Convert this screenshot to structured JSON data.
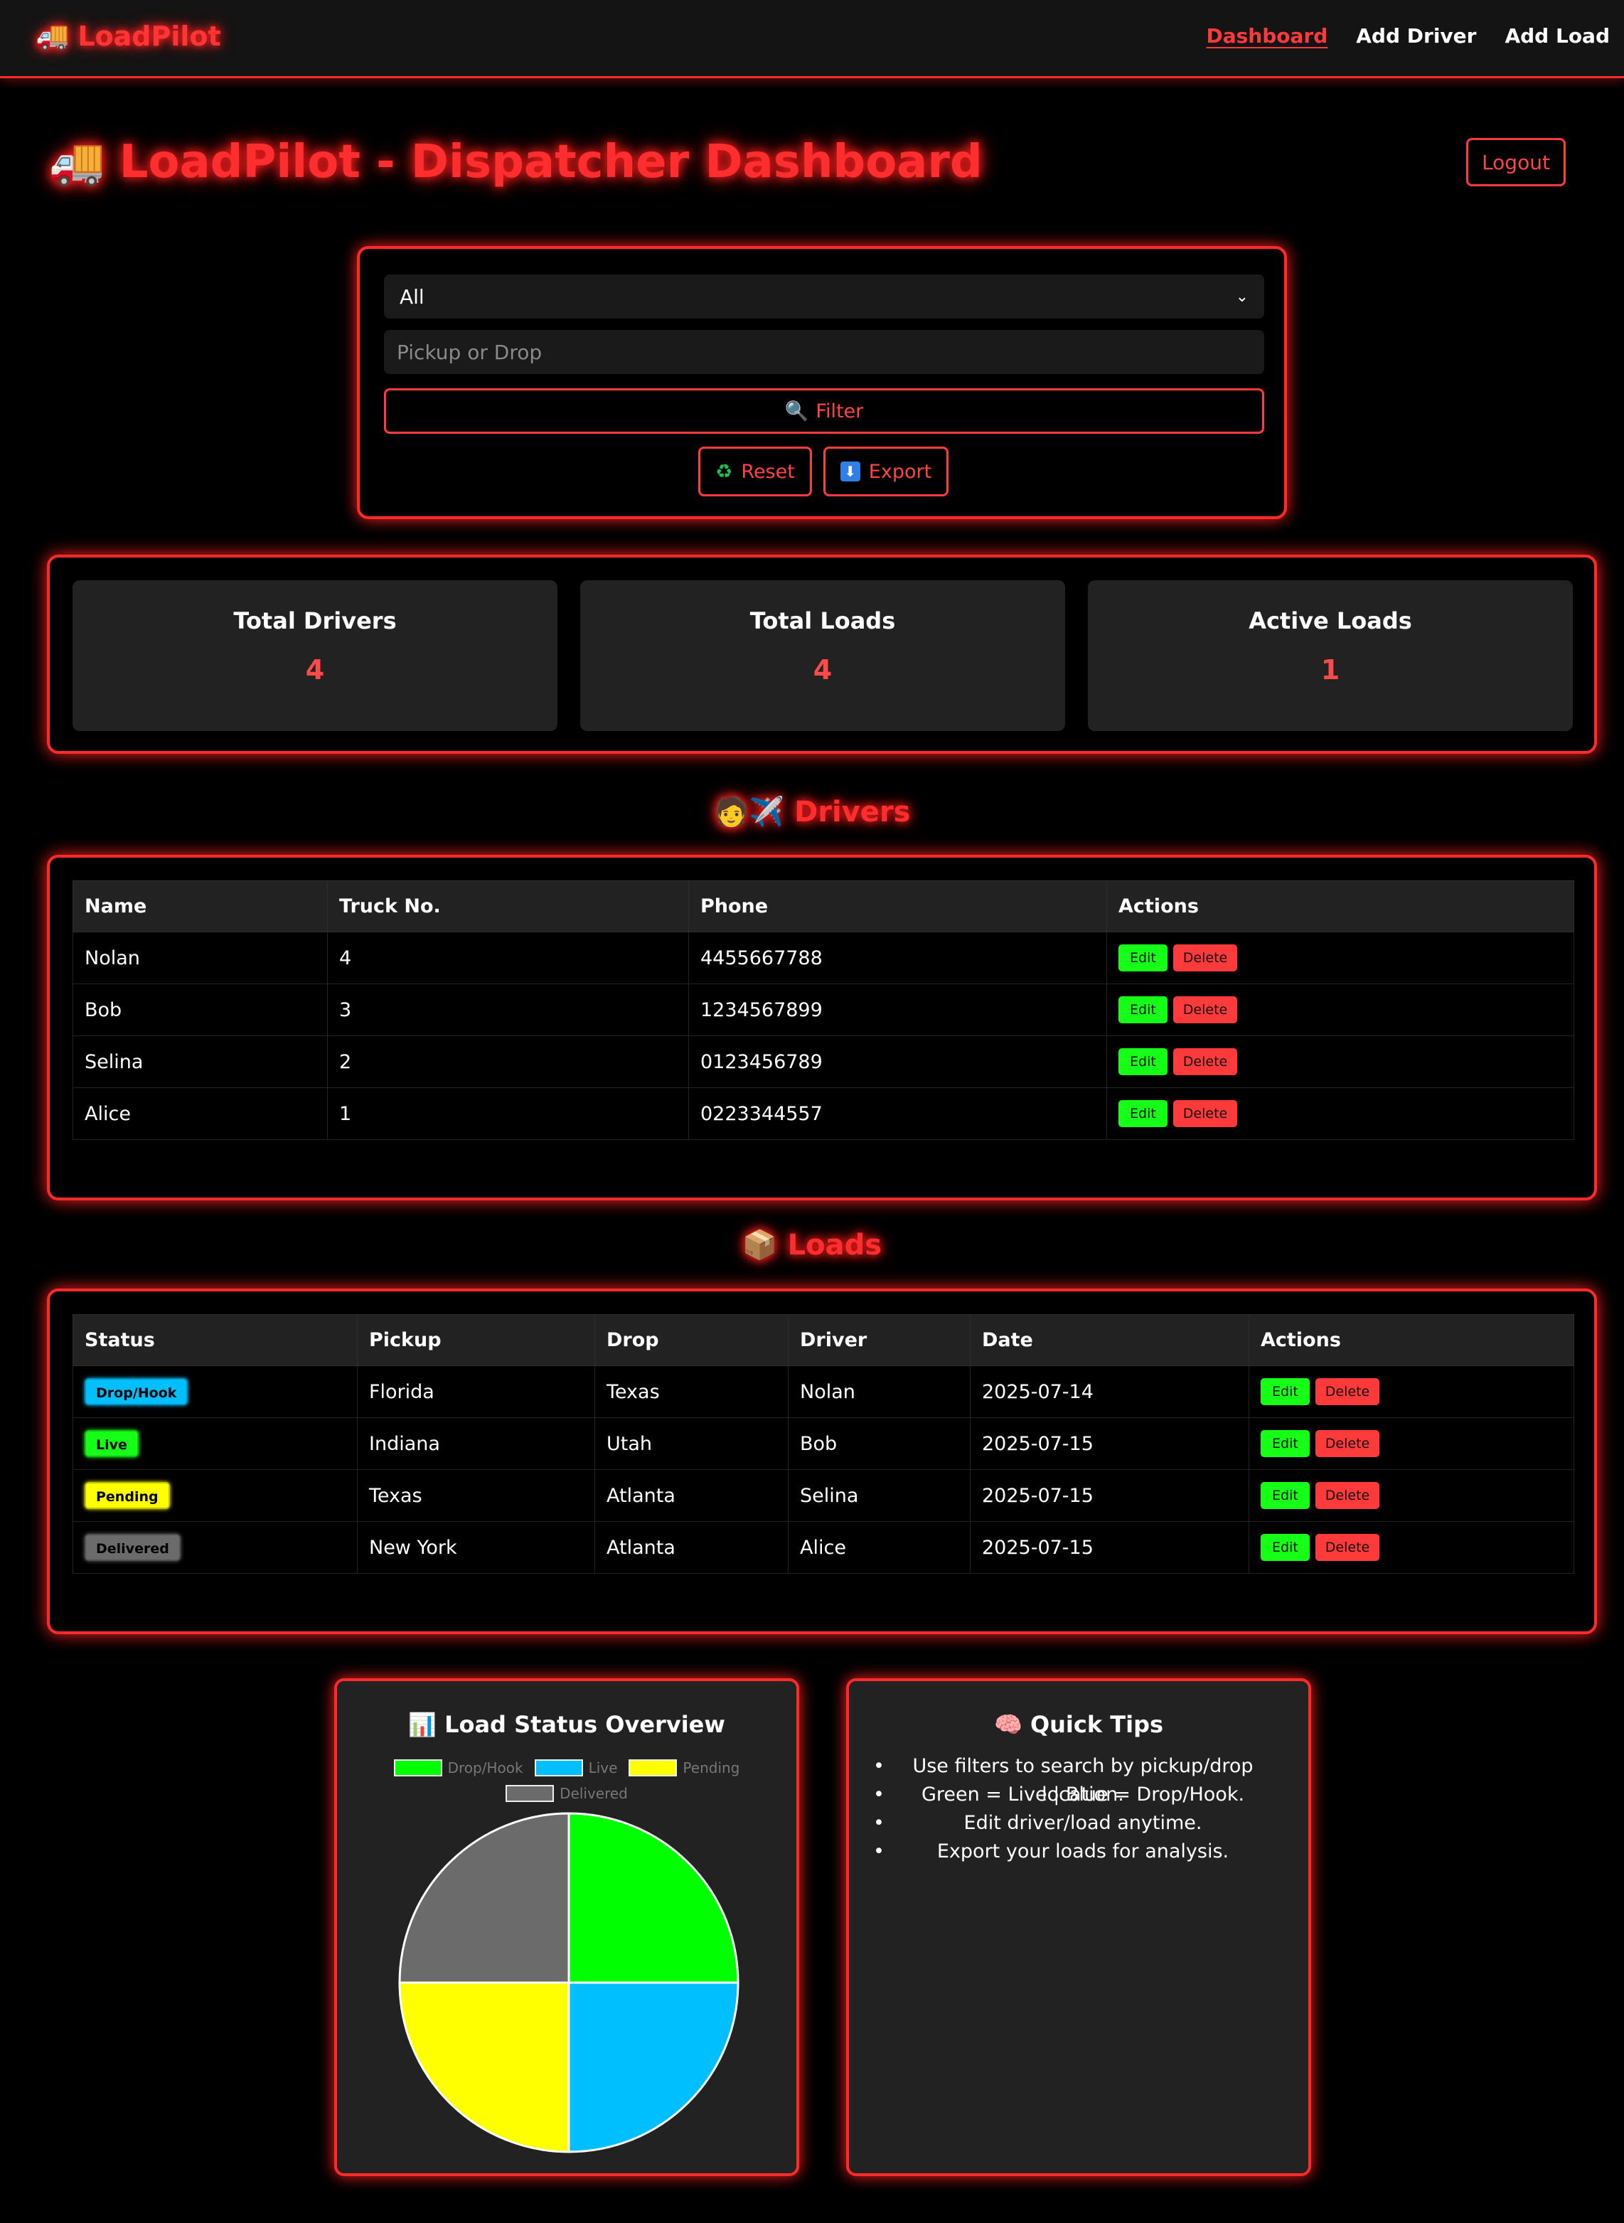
{
  "nav": {
    "brand": "LoadPilot",
    "brand_icon": "🚚",
    "links": [
      "Dashboard",
      "Add Driver",
      "Add Load"
    ],
    "active": "Dashboard"
  },
  "header": {
    "title": "LoadPilot - Dispatcher Dashboard",
    "title_icon": "🚚",
    "logout_label": "Logout"
  },
  "filter": {
    "status_selected": "All",
    "location_placeholder": "Pickup or Drop",
    "filter_icon": "🔍",
    "filter_label": "Filter",
    "reset_icon": "♻",
    "reset_label": "Reset",
    "export_icon": "⬇",
    "export_label": "Export"
  },
  "stats": [
    {
      "title": "Total Drivers",
      "value": "4"
    },
    {
      "title": "Total Loads",
      "value": "4"
    },
    {
      "title": "Active Loads",
      "value": "1"
    }
  ],
  "drivers": {
    "heading_icon": "🧑✈️",
    "heading": "Drivers",
    "columns": [
      "Name",
      "Truck No.",
      "Phone",
      "Actions"
    ],
    "rows": [
      {
        "name": "Nolan",
        "truck": "4",
        "phone": "4455667788"
      },
      {
        "name": "Bob",
        "truck": "3",
        "phone": "1234567899"
      },
      {
        "name": "Selina",
        "truck": "2",
        "phone": "0123456789"
      },
      {
        "name": "Alice",
        "truck": "1",
        "phone": "0223344557"
      }
    ],
    "edit_label": "Edit",
    "delete_label": "Delete"
  },
  "loads": {
    "heading_icon": "📦",
    "heading": "Loads",
    "columns": [
      "Status",
      "Pickup",
      "Drop",
      "Driver",
      "Date",
      "Actions"
    ],
    "rows": [
      {
        "status": "Drop/Hook",
        "status_color": "#00bfff",
        "pickup": "Florida",
        "drop": "Texas",
        "driver": "Nolan",
        "date": "2025-07-14"
      },
      {
        "status": "Live",
        "status_color": "#16ff16",
        "pickup": "Indiana",
        "drop": "Utah",
        "driver": "Bob",
        "date": "2025-07-15"
      },
      {
        "status": "Pending",
        "status_color": "#ffff00",
        "pickup": "Texas",
        "drop": "Atlanta",
        "driver": "Selina",
        "date": "2025-07-15"
      },
      {
        "status": "Delivered",
        "status_color": "#6b6b6b",
        "pickup": "New York",
        "drop": "Atlanta",
        "driver": "Alice",
        "date": "2025-07-15"
      }
    ],
    "edit_label": "Edit",
    "delete_label": "Delete"
  },
  "overview": {
    "icon": "📊",
    "title": "Load Status Overview"
  },
  "chart_data": {
    "type": "pie",
    "title": "Load Status Overview",
    "categories": [
      "Drop/Hook",
      "Live",
      "Pending",
      "Delivered"
    ],
    "values": [
      1,
      1,
      1,
      1
    ],
    "colors": [
      "#00ff00",
      "#00bfff",
      "#ffff00",
      "#6b6b6b"
    ],
    "legend": "top"
  },
  "tips": {
    "icon": "🧠",
    "title": "Quick Tips",
    "items": [
      "Use filters to search by pickup/drop location.",
      "Green = Live | Blue = Drop/Hook.",
      "Edit driver/load anytime.",
      "Export your loads for analysis."
    ]
  },
  "colors": {
    "accent": "#ff2a2a",
    "background": "#000000",
    "card": "#222222",
    "edit": "#16ff16",
    "delete": "#ff3a3a"
  }
}
